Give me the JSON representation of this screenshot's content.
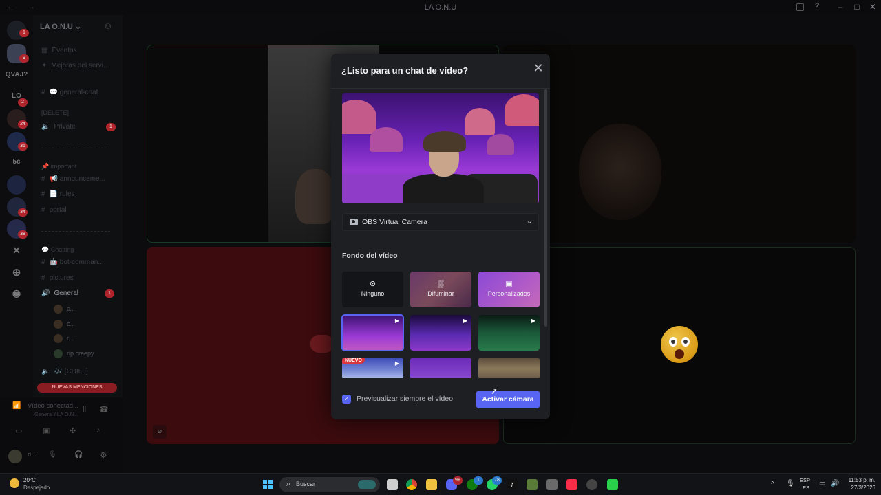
{
  "window": {
    "title": "LA O.N.U"
  },
  "server": {
    "name": "LA O.N.U"
  },
  "rail": {
    "items": [
      {
        "label": "",
        "badge": "1"
      },
      {
        "label": "",
        "badge": "9"
      },
      {
        "label": "QVAJ?",
        "badge": ""
      },
      {
        "label": "LO",
        "badge": "2"
      },
      {
        "label": "",
        "badge": "24"
      },
      {
        "label": "",
        "badge": "31"
      },
      {
        "label": "5c",
        "badge": ""
      },
      {
        "label": "",
        "badge": ""
      },
      {
        "label": "",
        "badge": "34"
      },
      {
        "label": "",
        "badge": "38"
      }
    ]
  },
  "sidebar": {
    "events": "Eventos",
    "improve": "Mejoras del servi...",
    "general_chat": "💬 general-chat",
    "delete_cat": "[DELETE]",
    "private": "Private",
    "private_badge": "1",
    "important_cat": "📌 important",
    "announcements": "📢 announceme...",
    "rules": "📄 rules",
    "portal": "portal",
    "chatting_cat": "💬 Chatting",
    "bot_commands": "🤖 bot-comman...",
    "pictures": "pictures",
    "general_voice": "General",
    "general_badge": "1",
    "voice_users": [
      "c...",
      "c...",
      "r...",
      "rip creepy"
    ],
    "chill": "🎶 [CHILL]",
    "mentions": "NUEVAS MENCIONES",
    "video_connected": "Vídeo conectad...",
    "voice_location": "General / LA O.N...",
    "user_name": "ri..."
  },
  "modal": {
    "title": "¿Listo para un chat de vídeo?",
    "camera": "OBS Virtual Camera",
    "background_section": "Fondo del vídeo",
    "options": [
      {
        "label": "Ninguno",
        "icon": "⊘"
      },
      {
        "label": "Difuminar",
        "icon": "▒"
      },
      {
        "label": "Personalizados",
        "icon": "▣"
      }
    ],
    "new_badge": "NUEVO",
    "always_preview": "Previsualizar siempre el vídeo",
    "always_preview_checked": true,
    "activate_camera": "Activar cámara"
  },
  "taskbar": {
    "temperature": "20°C",
    "condition": "Despejado",
    "search_placeholder": "Buscar",
    "lang_top": "ESP",
    "lang_bottom": "ES",
    "time": "11:53 p. m.",
    "date": "27/3/2026",
    "badges": {
      "discord": "9+",
      "xbox": "1",
      "whatsapp": "78"
    }
  },
  "colors": {
    "accent": "#5865f2",
    "danger": "#da373c",
    "modal_bg": "#1e1f23",
    "speaking_border": "#1c3b24"
  }
}
